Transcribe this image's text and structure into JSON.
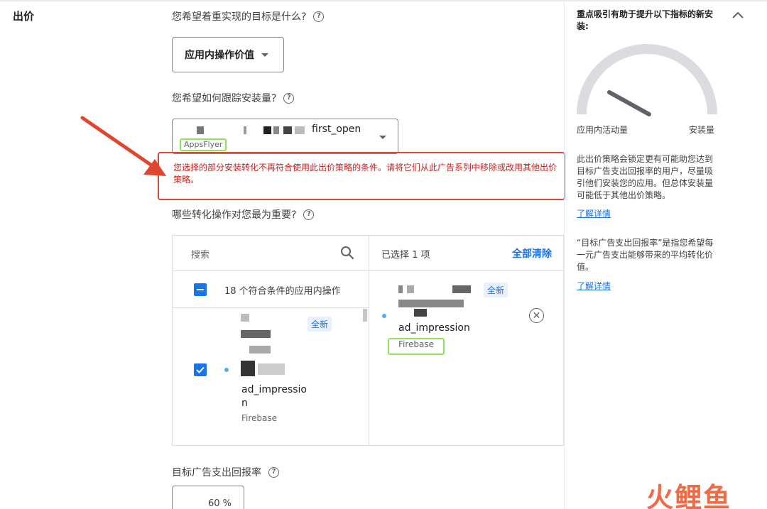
{
  "section": {
    "label": "出价"
  },
  "q1": {
    "label": "您希望着重实现的目标是什么?"
  },
  "goal_dropdown": {
    "value": "应用内操作价值"
  },
  "q2": {
    "label": "您希望如何跟踪安装量?"
  },
  "install_dropdown": {
    "value": "first_open",
    "source": "AppsFlyer"
  },
  "error": {
    "message": "您选择的部分安装转化不再符合使用此出价策略的条件。请将它们从此广告系列中移除或改用其他出价策略。"
  },
  "q3": {
    "label": "哪些转化操作对您最为重要?"
  },
  "left_panel": {
    "search_placeholder": "搜索",
    "count_label": "18 个符合条件的应用内操作",
    "items": [
      {
        "name_line1": "ad_impressio",
        "name_line2": "n",
        "source": "Firebase",
        "badge": "全新"
      }
    ]
  },
  "right_panel": {
    "selected_label": "已选择 1 项",
    "clear_all": "全部清除",
    "items": [
      {
        "name": "ad_impression",
        "source": "Firebase",
        "badge": "全新"
      }
    ]
  },
  "roas": {
    "label": "目标广告支出回报率",
    "value": "60 %"
  },
  "sidebar": {
    "title": "重点吸引有助于提升以下指标的新安装:",
    "gauge_left": "应用内活动量",
    "gauge_right": "安装量",
    "paragraph1": "此出价策略会锁定更有可能助您达到目标广告支出回报率的用户，尽量吸引他们安装您的应用。但总体安装量可能低于其他出价策略。",
    "link1": "了解详情",
    "paragraph2": "“目标广告支出回报率”是指您希望每一元广告支出能够带来的平均转化价值。",
    "link2": "了解详情"
  },
  "watermark": {
    "text": "火鲤鱼"
  },
  "colors": {
    "accent": "#1a73e8",
    "error": "#c5221f",
    "highlight": "#8fe35a",
    "annotation": "#e0452f"
  }
}
